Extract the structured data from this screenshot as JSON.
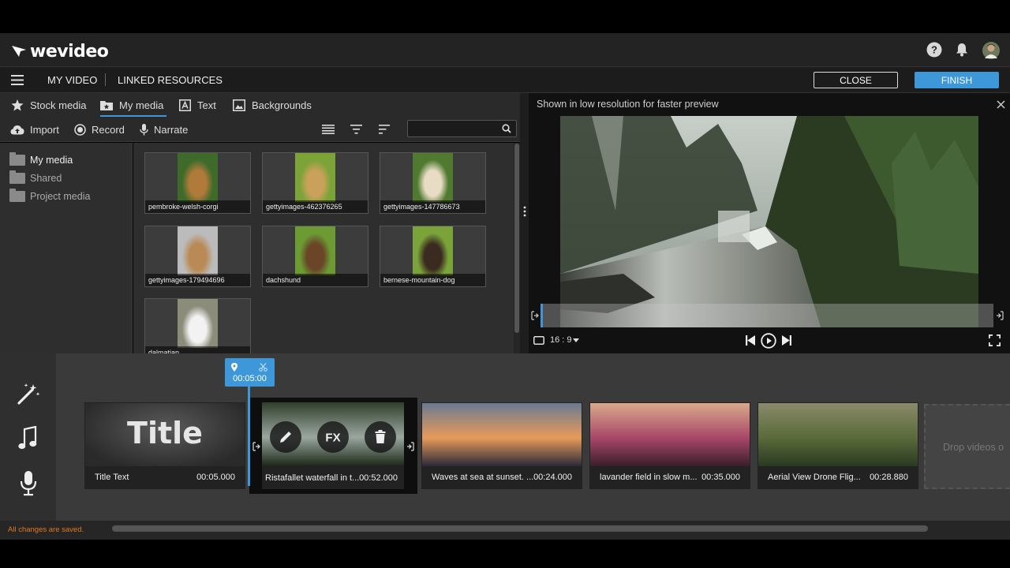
{
  "app": {
    "logo_text": "wevideo"
  },
  "menu": {
    "my_video": "MY VIDEO",
    "linked_resources": "LINKED RESOURCES",
    "close_label": "CLOSE",
    "finish_label": "FINISH"
  },
  "media_tabs": [
    {
      "label": "Stock media",
      "icon": "star-icon"
    },
    {
      "label": "My media",
      "icon": "folder-star-icon",
      "active": true
    },
    {
      "label": "Text",
      "icon": "text-icon"
    },
    {
      "label": "Backgrounds",
      "icon": "image-icon"
    }
  ],
  "media_tools": {
    "import_label": "Import",
    "record_label": "Record",
    "narrate_label": "Narrate",
    "search_placeholder": ""
  },
  "folders": [
    {
      "label": "My media",
      "active": true
    },
    {
      "label": "Shared"
    },
    {
      "label": "Project media"
    }
  ],
  "media_items": [
    {
      "name": "pembroke-welsh-corgi",
      "colors": [
        "#3f6b2a",
        "#b07a3a"
      ]
    },
    {
      "name": "gettyimages-462376265",
      "colors": [
        "#7ba338",
        "#c9a15a"
      ]
    },
    {
      "name": "gettyimages-147786673",
      "colors": [
        "#4f7a2f",
        "#e8dcc4"
      ]
    },
    {
      "name": "gettyimages-179494696",
      "colors": [
        "#bbbbbb",
        "#b98a55"
      ]
    },
    {
      "name": "dachshund",
      "colors": [
        "#6c9b34",
        "#6a4528"
      ]
    },
    {
      "name": "bernese-mountain-dog",
      "colors": [
        "#7aa43a",
        "#3b2a20"
      ]
    },
    {
      "name": "dalmatian",
      "colors": [
        "#8c8c7a",
        "#f2f2f2"
      ]
    }
  ],
  "preview": {
    "notice": "Shown in low resolution for faster preview",
    "aspect_ratio": "16 : 9"
  },
  "playhead": {
    "time": "00:05:00"
  },
  "clips": [
    {
      "label": "Title Text",
      "duration": "00:05.000",
      "title_overlay": "Title",
      "type": "title"
    },
    {
      "label": "Ristafallet waterfall in t...",
      "duration": "00:52.000",
      "selected": true,
      "colors": [
        "#2f3f2a",
        "#9aa7a0",
        "#1e2a1a"
      ]
    },
    {
      "label": "Waves at sea at sunset. ...",
      "duration": "00:24.000",
      "colors": [
        "#6a7a92",
        "#e89a5a",
        "#2a2a3a"
      ]
    },
    {
      "label": "lavander field in slow m...",
      "duration": "00:35.000",
      "colors": [
        "#d9a98a",
        "#a8476a",
        "#3a1e2a"
      ]
    },
    {
      "label": "Aerial View Drone Flig...",
      "duration": "00:28.880",
      "colors": [
        "#8a8a6a",
        "#5a6a3a",
        "#2a3a22"
      ]
    }
  ],
  "drop_zone_label": "Drop videos o",
  "status": {
    "saved": "All changes are saved."
  },
  "colors": {
    "accent": "#3d97d8",
    "status": "#e0781e"
  }
}
